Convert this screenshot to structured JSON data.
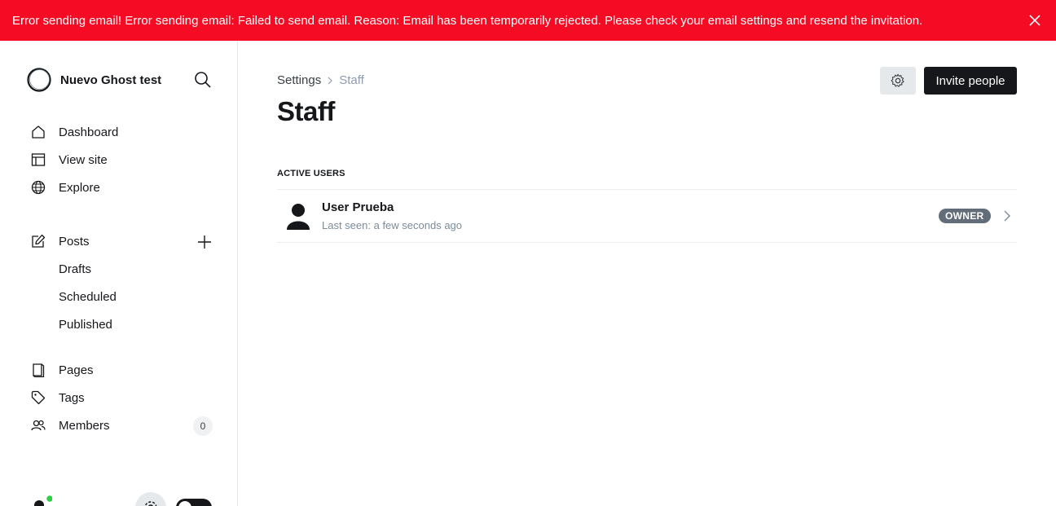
{
  "alert": {
    "message": "Error sending email! Error sending email: Failed to send email. Reason: Email has been temporarily rejected. Please check your email settings and resend the invitation.",
    "close_icon": "close-icon",
    "color": "#f50b23"
  },
  "sidebar": {
    "site_title": "Nuevo Ghost test",
    "search_icon": "search-icon",
    "items": {
      "dashboard": "Dashboard",
      "view_site": "View site",
      "explore": "Explore",
      "posts": "Posts",
      "drafts": "Drafts",
      "scheduled": "Scheduled",
      "published": "Published",
      "pages": "Pages",
      "tags": "Tags",
      "members": "Members"
    },
    "members_count": "0"
  },
  "main": {
    "breadcrumb": {
      "parent": "Settings",
      "current": "Staff"
    },
    "title": "Staff",
    "invite_label": "Invite people",
    "section_label": "ACTIVE USERS",
    "users": [
      {
        "name": "User Prueba",
        "last_seen": "Last seen: a few seconds ago",
        "role": "OWNER"
      }
    ]
  },
  "colors": {
    "accent_dark": "#15171a",
    "badge_gray": "#626d79",
    "online_dot": "#30cf43"
  }
}
